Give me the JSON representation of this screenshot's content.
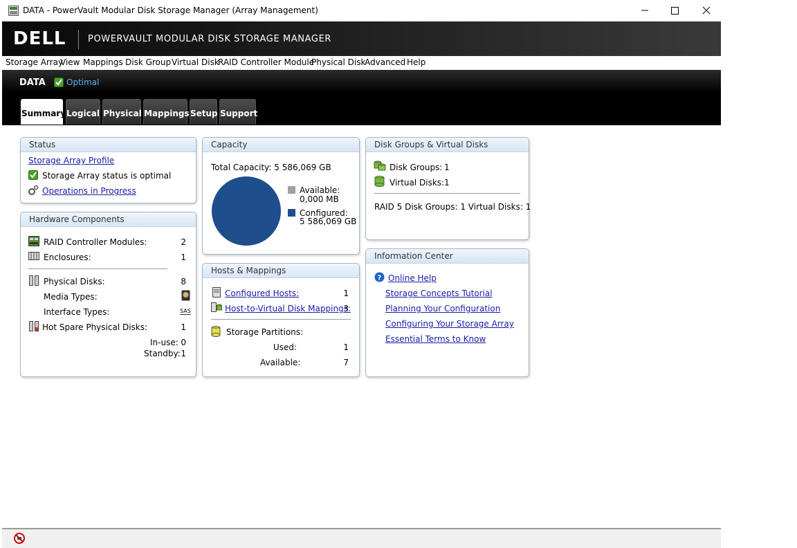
{
  "window": {
    "title": "DATA - PowerVault Modular Disk Storage Manager (Array Management)"
  },
  "banner": {
    "logo": "DELL",
    "title": "POWERVAULT MODULAR DISK STORAGE MANAGER"
  },
  "menu": [
    "Storage Array",
    "View",
    "Mappings",
    "Disk Group",
    "Virtual Disk",
    "RAID Controller Module",
    "Physical Disk",
    "Advanced",
    "Help"
  ],
  "header": {
    "array_name": "DATA",
    "status": "Optimal"
  },
  "tabs": [
    "Summary",
    "Logical",
    "Physical",
    "Mappings",
    "Setup",
    "Support"
  ],
  "status_panel": {
    "title": "Status",
    "profile_link": "Storage Array Profile",
    "status_text": "Storage Array status is optimal",
    "operations_link": "Operations in Progress"
  },
  "hardware_panel": {
    "title": "Hardware Components",
    "controllers_label": "RAID Controller Modules:",
    "controllers_value": "2",
    "enclosures_label": "Enclosures:",
    "enclosures_value": "1",
    "disks_label": "Physical Disks:",
    "disks_value": "8",
    "media_label": "Media Types:",
    "interface_label": "Interface Types:",
    "interface_icon_text": "SAS",
    "hotspare_label": "Hot Spare Physical Disks:",
    "hotspare_value": "1",
    "inuse_label": "In-use:",
    "inuse_value": "0",
    "standby_label": "Standby:",
    "standby_value": "1"
  },
  "capacity_panel": {
    "title": "Capacity",
    "total": "Total Capacity: 5 586,069 GB",
    "available_label": "Available:",
    "available_value": "0,000 MB",
    "configured_label": "Configured:",
    "configured_value": "5 586,069 GB"
  },
  "hosts_panel": {
    "title": "Hosts & Mappings",
    "hosts_link": "Configured Hosts:",
    "hosts_value": "1",
    "mappings_link": "Host-to-Virtual Disk Mappings:",
    "mappings_value": "3",
    "partitions_label": "Storage Partitions:",
    "used_label": "Used:",
    "used_value": "1",
    "available_label": "Available:",
    "available_value": "7"
  },
  "dg_panel": {
    "title": "Disk Groups & Virtual Disks",
    "dg_label": "Disk Groups:",
    "dg_value": "1",
    "vd_label": "Virtual Disks:",
    "vd_value": "1",
    "raid_text": "RAID 5 Disk Groups: 1  Virtual Disks: 1"
  },
  "info_panel": {
    "title": "Information Center",
    "links": [
      "Online Help",
      "Storage Concepts Tutorial",
      "Planning Your Configuration",
      "Configuring Your Storage Array",
      "Essential Terms to Know"
    ]
  },
  "colors": {
    "configured": "#1f4e8c",
    "available": "#a0a0a0",
    "optimal": "#5ab0ec",
    "link": "#1a1aa6"
  },
  "icons": [
    "app-icon",
    "minimize-icon",
    "maximize-icon",
    "close-icon",
    "check-icon",
    "gears-icon",
    "controller-icon",
    "enclosure-icon",
    "physical-disk-icon",
    "media-disk-icon",
    "sas-icon",
    "hot-spare-icon",
    "host-icon",
    "mapping-icon",
    "partition-icon",
    "disk-group-icon",
    "virtual-disk-icon",
    "help-icon",
    "no-entry-icon"
  ]
}
